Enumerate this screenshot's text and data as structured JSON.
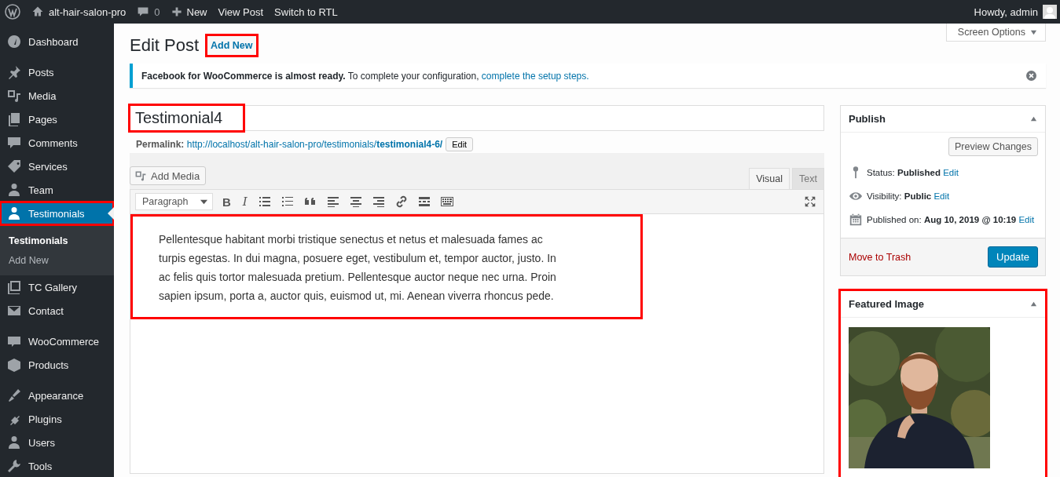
{
  "admin_bar": {
    "site": "alt-hair-salon-pro",
    "comments": "0",
    "new": "New",
    "links": [
      "View Post",
      "Switch to RTL"
    ],
    "greeting": "Howdy, admin"
  },
  "sidebar": {
    "groups": [
      {
        "items": [
          {
            "label": "Dashboard",
            "current": false,
            "highlighted": false
          }
        ]
      },
      {
        "items": [
          {
            "label": "Posts",
            "current": false,
            "highlighted": false
          },
          {
            "label": "Media",
            "current": false,
            "highlighted": false
          },
          {
            "label": "Pages",
            "current": false,
            "highlighted": false
          },
          {
            "label": "Comments",
            "current": false,
            "highlighted": false
          },
          {
            "label": "Services",
            "current": false,
            "highlighted": false
          },
          {
            "label": "Team",
            "current": false,
            "highlighted": false
          },
          {
            "label": "Testimonials",
            "current": true,
            "highlighted": true,
            "submenu": [
              {
                "label": "Testimonials",
                "selected": true
              },
              {
                "label": "Add New",
                "selected": false
              }
            ]
          },
          {
            "label": "TC Gallery",
            "current": false,
            "highlighted": false
          },
          {
            "label": "Contact",
            "current": false,
            "highlighted": false
          }
        ]
      },
      {
        "items": [
          {
            "label": "WooCommerce",
            "current": false,
            "highlighted": false
          },
          {
            "label": "Products",
            "current": false,
            "highlighted": false
          }
        ]
      },
      {
        "items": [
          {
            "label": "Appearance",
            "current": false,
            "highlighted": false
          },
          {
            "label": "Plugins",
            "current": false,
            "highlighted": false
          },
          {
            "label": "Users",
            "current": false,
            "highlighted": false
          },
          {
            "label": "Tools",
            "current": false,
            "highlighted": false
          }
        ]
      }
    ]
  },
  "screen_options": "Screen Options",
  "header": {
    "title": "Edit Post",
    "add_new": "Add New",
    "add_new_highlighted": true
  },
  "notice": {
    "text": "**Facebook for WooCommerce is almost ready.** To complete your configuration,",
    "link": "complete the setup steps."
  },
  "post": {
    "title": "Testimonial4",
    "title_highlighted": true,
    "permalink_label": "Permalink:",
    "permalink_base": "http://localhost/alt-hair-salon-pro/testimonials/",
    "permalink_slug": "testimonial4-6/",
    "permalink_edit": "Edit"
  },
  "editor": {
    "add_media": "Add Media",
    "tabs": [
      {
        "label": "Visual",
        "selected": true
      },
      {
        "label": "Text",
        "selected": false
      }
    ],
    "format": "Paragraph",
    "bold": "B",
    "italic": "I",
    "content": "Pellentesque habitant morbi tristique senectus et netus et malesuada fames ac turpis egestas. In dui magna, posuere eget, vestibulum et, tempor auctor, justo. In ac felis quis tortor malesuada pretium. Pellentesque auctor neque nec urna. Proin sapien ipsum, porta a, auctor quis, euismod ut, mi. Aenean viverra rhoncus pede.",
    "content_highlighted": true
  },
  "publish": {
    "title": "Publish",
    "preview": "Preview Changes",
    "rows": [
      {
        "label": "Status:",
        "value": "Published",
        "edit": "Edit"
      },
      {
        "label": "Visibility:",
        "value": "Public",
        "edit": "Edit"
      },
      {
        "label": "Published on:",
        "value": "Aug 10, 2019 @ 10:19",
        "edit": "Edit"
      }
    ],
    "trash": "Move to Trash",
    "update": "Update"
  },
  "featured_image": {
    "title": "Featured Image",
    "highlighted": true
  }
}
